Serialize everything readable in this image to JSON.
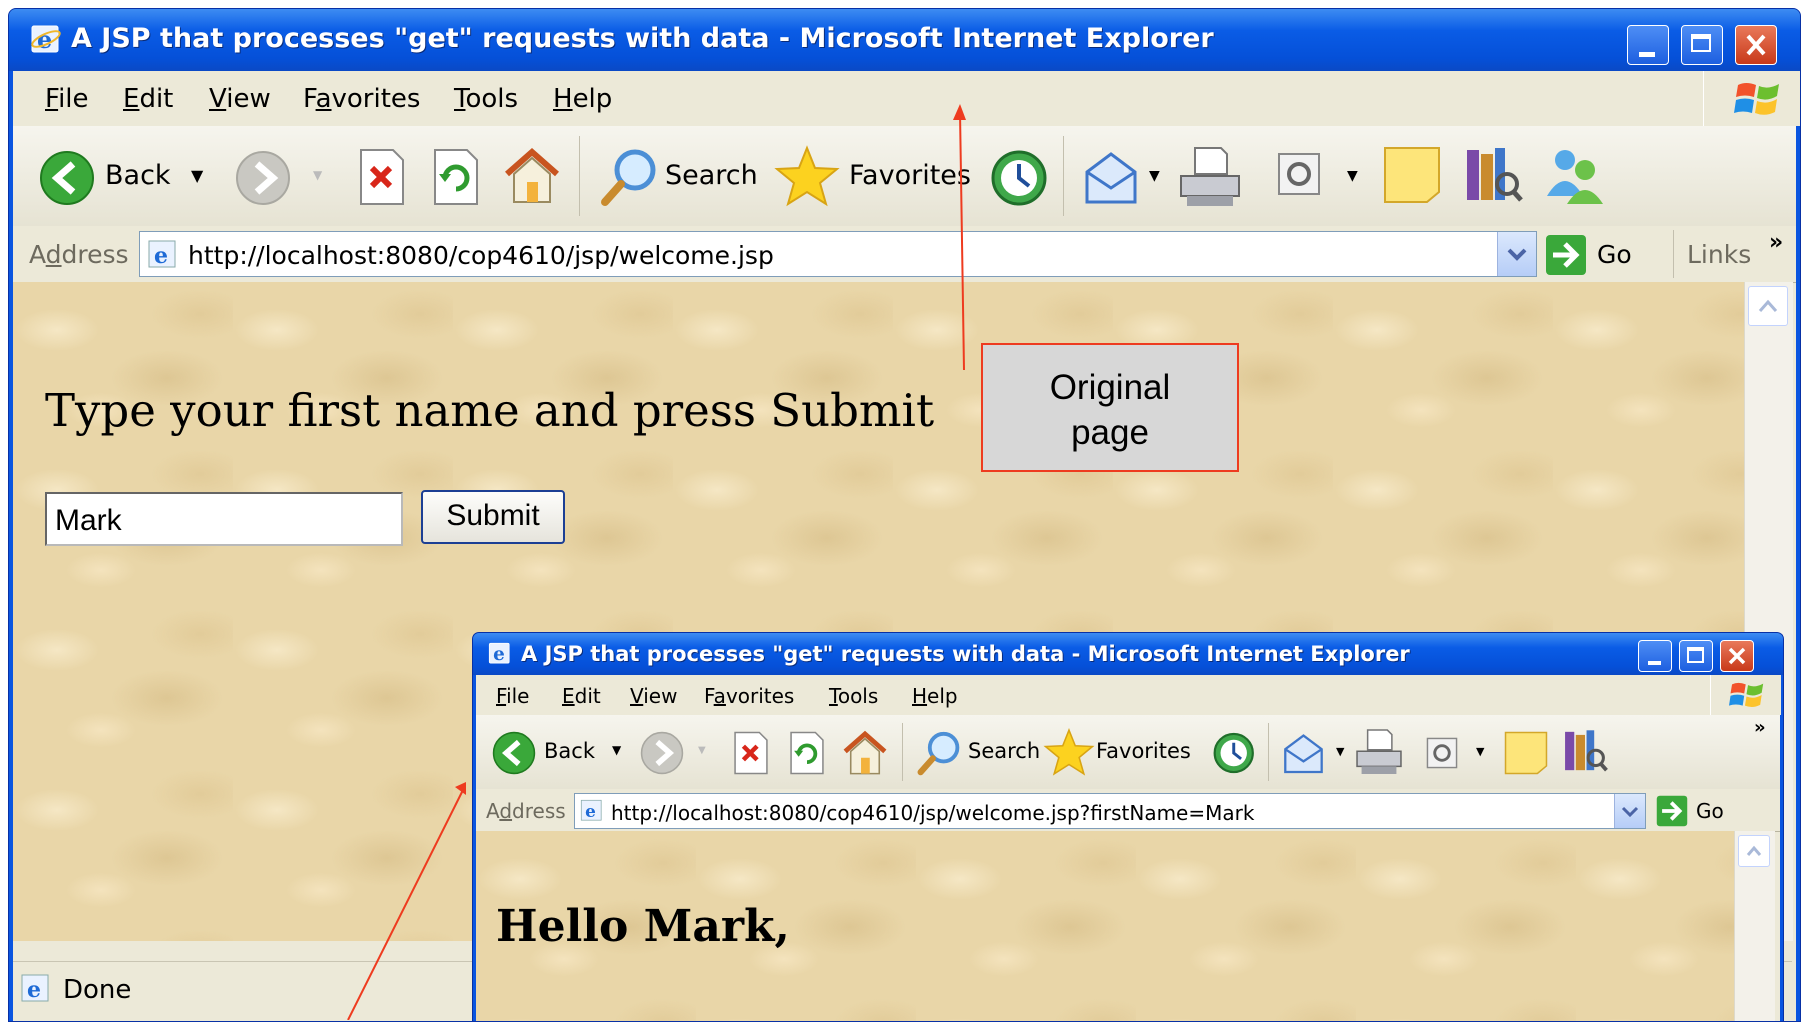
{
  "window_title": "A JSP that processes \"get\" requests with data - Microsoft Internet Explorer",
  "menu": [
    {
      "label": "File",
      "key": "F",
      "rest": "ile"
    },
    {
      "label": "Edit",
      "key": "E",
      "rest": "dit"
    },
    {
      "label": "View",
      "key": "V",
      "rest": "iew"
    },
    {
      "label": "Favorites",
      "pre": "F",
      "key": "a",
      "rest": "vorites"
    },
    {
      "label": "Tools",
      "key": "T",
      "rest": "ools"
    },
    {
      "label": "Help",
      "key": "H",
      "rest": "elp"
    }
  ],
  "toolbar": {
    "back": "Back",
    "search": "Search",
    "favorites": "Favorites"
  },
  "address": {
    "label": "Address",
    "label_key": "d",
    "go": "Go",
    "links": "Links"
  },
  "original": {
    "url": "http://localhost:8080/cop4610/jsp/welcome.jsp",
    "heading": "Type your first name and press Submit",
    "input_value": "Mark",
    "submit_label": "Submit",
    "status": "Done"
  },
  "response": {
    "url": "http://localhost:8080/cop4610/jsp/welcome.jsp?firstName=Mark",
    "heading": "Hello Mark,"
  },
  "callout": {
    "line1": "Original",
    "line2": "page"
  },
  "colors": {
    "title_bar": "#0a5ce6",
    "callout_border": "#ee3b1f",
    "arrow": "#ee3b1f",
    "content_bg": "#e9d6a8"
  },
  "icons": [
    "ie-icon",
    "back-arrow-icon",
    "forward-arrow-icon",
    "stop-icon",
    "refresh-icon",
    "home-icon",
    "search-magnifier-icon",
    "favorites-star-icon",
    "history-icon",
    "mail-icon",
    "print-icon",
    "edit-icon",
    "messenger-icon",
    "research-icon",
    "messenger-people-icon",
    "go-arrow-icon",
    "windows-logo-icon",
    "minimize-icon",
    "maximize-icon",
    "close-icon"
  ]
}
